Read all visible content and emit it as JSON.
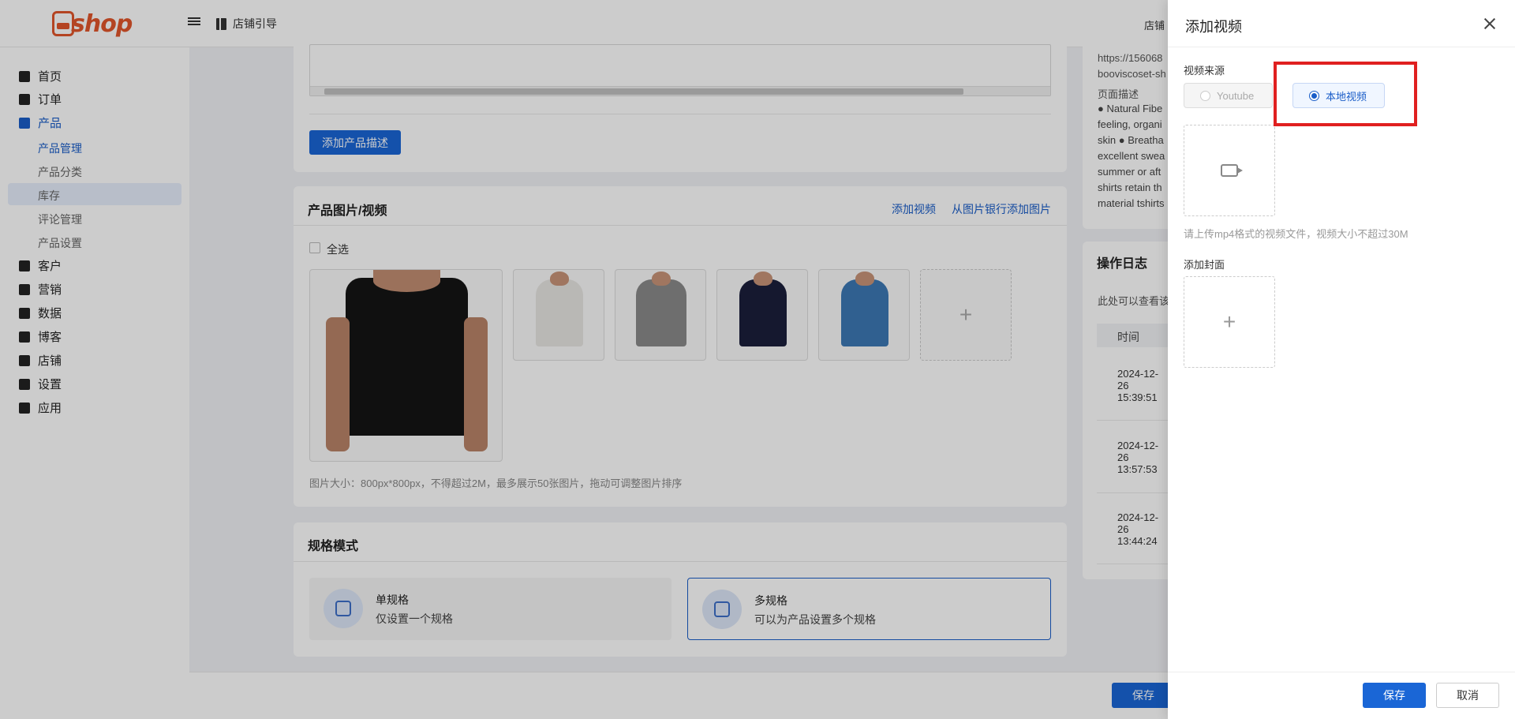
{
  "header": {
    "logo_text": "shop",
    "guide_label": "店铺引导",
    "store_label": "店铺"
  },
  "sidebar": {
    "items": [
      {
        "label": "首页",
        "icon": "home-icon"
      },
      {
        "label": "订单",
        "icon": "order-icon"
      },
      {
        "label": "产品",
        "icon": "bag-icon"
      },
      {
        "label": "客户",
        "icon": "customer-icon"
      },
      {
        "label": "营销",
        "icon": "tag-icon"
      },
      {
        "label": "数据",
        "icon": "chart-icon"
      },
      {
        "label": "博客",
        "icon": "blog-icon"
      },
      {
        "label": "店铺",
        "icon": "store-icon"
      },
      {
        "label": "设置",
        "icon": "gear-icon"
      },
      {
        "label": "应用",
        "icon": "puzzle-icon"
      }
    ],
    "product_sub": [
      "产品管理",
      "产品分类",
      "库存",
      "评论管理",
      "产品设置"
    ]
  },
  "main": {
    "add_desc_button": "添加产品描述",
    "media_title": "产品图片/视频",
    "add_video_link": "添加视频",
    "add_from_bank_link": "从图片银行添加图片",
    "select_all": "全选",
    "image_hint": "图片大小：800px*800px，不得超过2M，最多展示50张图片，拖动可调整图片排序",
    "spec_title": "规格模式",
    "single_spec_title": "单规格",
    "single_spec_desc": "仅设置一个规格",
    "multi_spec_title": "多规格",
    "multi_spec_desc": "可以为产品设置多个规格",
    "save_button": "保存"
  },
  "right_panel": {
    "url_lines": [
      "https://156068",
      "booviscoset-sh"
    ],
    "page_desc_label": "页面描述",
    "desc_lines": [
      "● Natural Fibe",
      "feeling, organi",
      "skin ● Breatha",
      "excellent swea",
      "summer or aft",
      "shirts retain th",
      "material tshirts"
    ],
    "log_title": "操作日志",
    "log_hint": "此处可以查看该",
    "log_col_time": "时间",
    "log_times": [
      [
        "2024-12-",
        "26",
        "15:39:51"
      ],
      [
        "2024-12-",
        "26",
        "13:57:53"
      ],
      [
        "2024-12-",
        "26",
        "13:44:24"
      ]
    ]
  },
  "drawer": {
    "title": "添加视频",
    "source_label": "视频来源",
    "option_youtube": "Youtube",
    "option_local": "本地视频",
    "upload_hint": "请上传mp4格式的视频文件，视频大小不超过30M",
    "cover_label": "添加封面",
    "save_button": "保存",
    "cancel_button": "取消"
  },
  "colors": {
    "primary": "#1a66d6",
    "brand": "#e2562b",
    "highlight": "#e02020"
  }
}
